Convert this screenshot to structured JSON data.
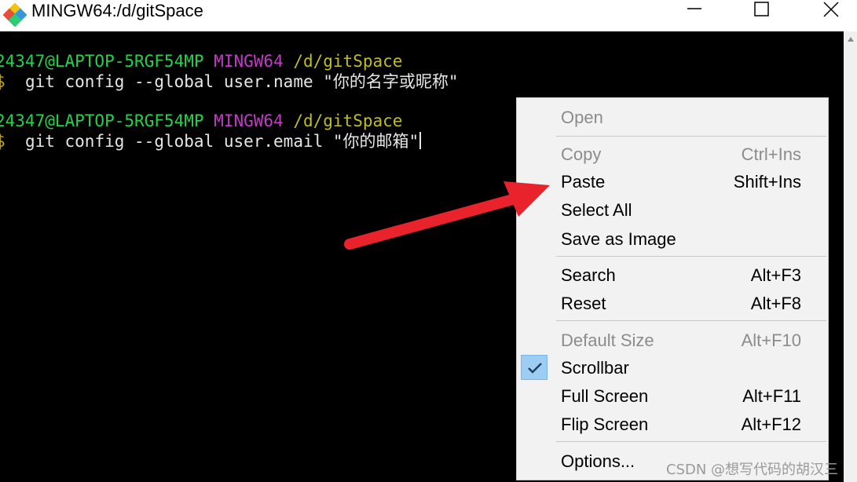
{
  "window": {
    "title": "MINGW64:/d/gitSpace",
    "icon": "git-for-windows-diamond-icon"
  },
  "terminal": {
    "lines": [
      {
        "user_host": "24347@LAPTOP-5RGF54MP",
        "shell": "MINGW64",
        "path": "/d/gitSpace"
      },
      {
        "prompt": "$",
        "command": "git config --global user.name \"你的名字或昵称\""
      },
      {
        "user_host": "24347@LAPTOP-5RGF54MP",
        "shell": "MINGW64",
        "path": "/d/gitSpace"
      },
      {
        "prompt": "$",
        "command": "git config --global user.email \"你的邮箱\""
      }
    ]
  },
  "context_menu": {
    "items": [
      {
        "label": "Open",
        "shortcut": "",
        "disabled": true
      },
      {
        "label": "Copy",
        "shortcut": "Ctrl+Ins",
        "disabled": true
      },
      {
        "label": "Paste",
        "shortcut": "Shift+Ins",
        "disabled": false
      },
      {
        "label": "Select All",
        "shortcut": "",
        "disabled": false
      },
      {
        "label": "Save as Image",
        "shortcut": "",
        "disabled": false
      },
      {
        "label": "Search",
        "shortcut": "Alt+F3",
        "disabled": false
      },
      {
        "label": "Reset",
        "shortcut": "Alt+F8",
        "disabled": false
      },
      {
        "label": "Default Size",
        "shortcut": "Alt+F10",
        "disabled": true
      },
      {
        "label": "Scrollbar",
        "shortcut": "",
        "disabled": false,
        "checked": true
      },
      {
        "label": "Full Screen",
        "shortcut": "Alt+F11",
        "disabled": false
      },
      {
        "label": "Flip Screen",
        "shortcut": "Alt+F12",
        "disabled": false
      },
      {
        "label": "Options...",
        "shortcut": "",
        "disabled": false
      }
    ]
  },
  "colors": {
    "user_host": "#24d14a",
    "shell": "#c23bc5",
    "path": "#c0bd23",
    "annotation_arrow": "#e8232b",
    "check_highlight": "#9dcdf2"
  },
  "watermark": "CSDN @想写代码的胡汉三"
}
